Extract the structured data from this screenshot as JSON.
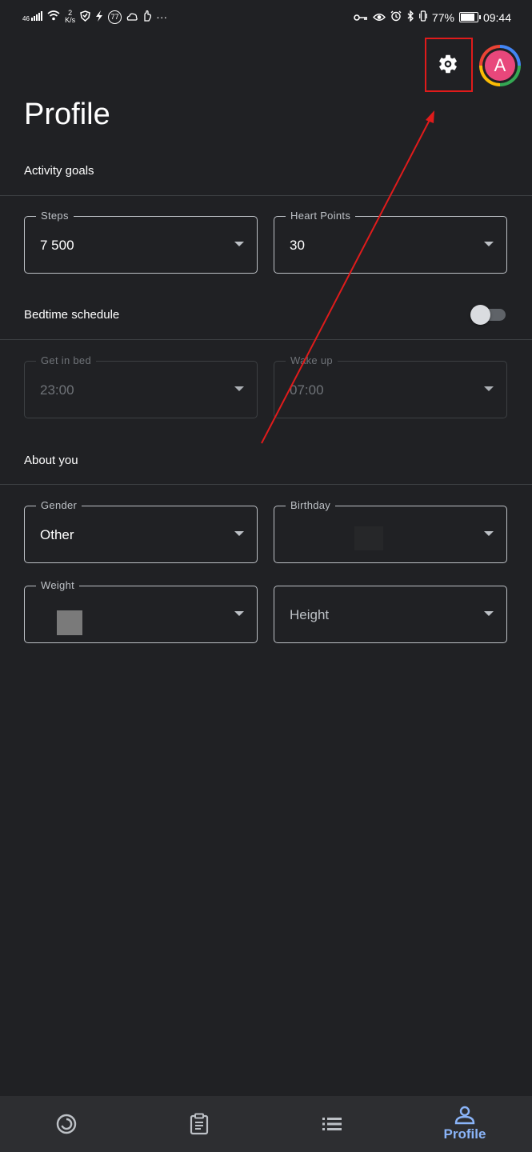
{
  "status_bar": {
    "signal": "46",
    "net_speed_value": "2",
    "net_speed_unit": "K/s",
    "badge": "77",
    "more": "···",
    "battery_percent": "77%",
    "time": "09:44"
  },
  "header": {
    "title": "Profile",
    "avatar_letter": "A"
  },
  "activity_goals": {
    "heading": "Activity goals",
    "steps": {
      "label": "Steps",
      "value": "7 500"
    },
    "heart_points": {
      "label": "Heart Points",
      "value": "30"
    }
  },
  "bedtime": {
    "heading": "Bedtime schedule",
    "toggle_on": false,
    "get_in_bed": {
      "label": "Get in bed",
      "value": "23:00"
    },
    "wake_up": {
      "label": "Wake up",
      "value": "07:00"
    }
  },
  "about_you": {
    "heading": "About you",
    "gender": {
      "label": "Gender",
      "value": "Other"
    },
    "birthday": {
      "label": "Birthday",
      "value": ""
    },
    "weight": {
      "label": "Weight",
      "value": ""
    },
    "height": {
      "placeholder": "Height"
    }
  },
  "bottom_nav": {
    "items": [
      {
        "icon": "home-ring-icon",
        "label": ""
      },
      {
        "icon": "journal-clipboard-icon",
        "label": ""
      },
      {
        "icon": "browse-list-icon",
        "label": ""
      },
      {
        "icon": "profile-person-icon",
        "label": "Profile",
        "active": true
      }
    ]
  },
  "colors": {
    "background": "#202124",
    "accent": "#8ab4f8",
    "avatar": "#e8477b",
    "annotation": "#e01b1b"
  }
}
